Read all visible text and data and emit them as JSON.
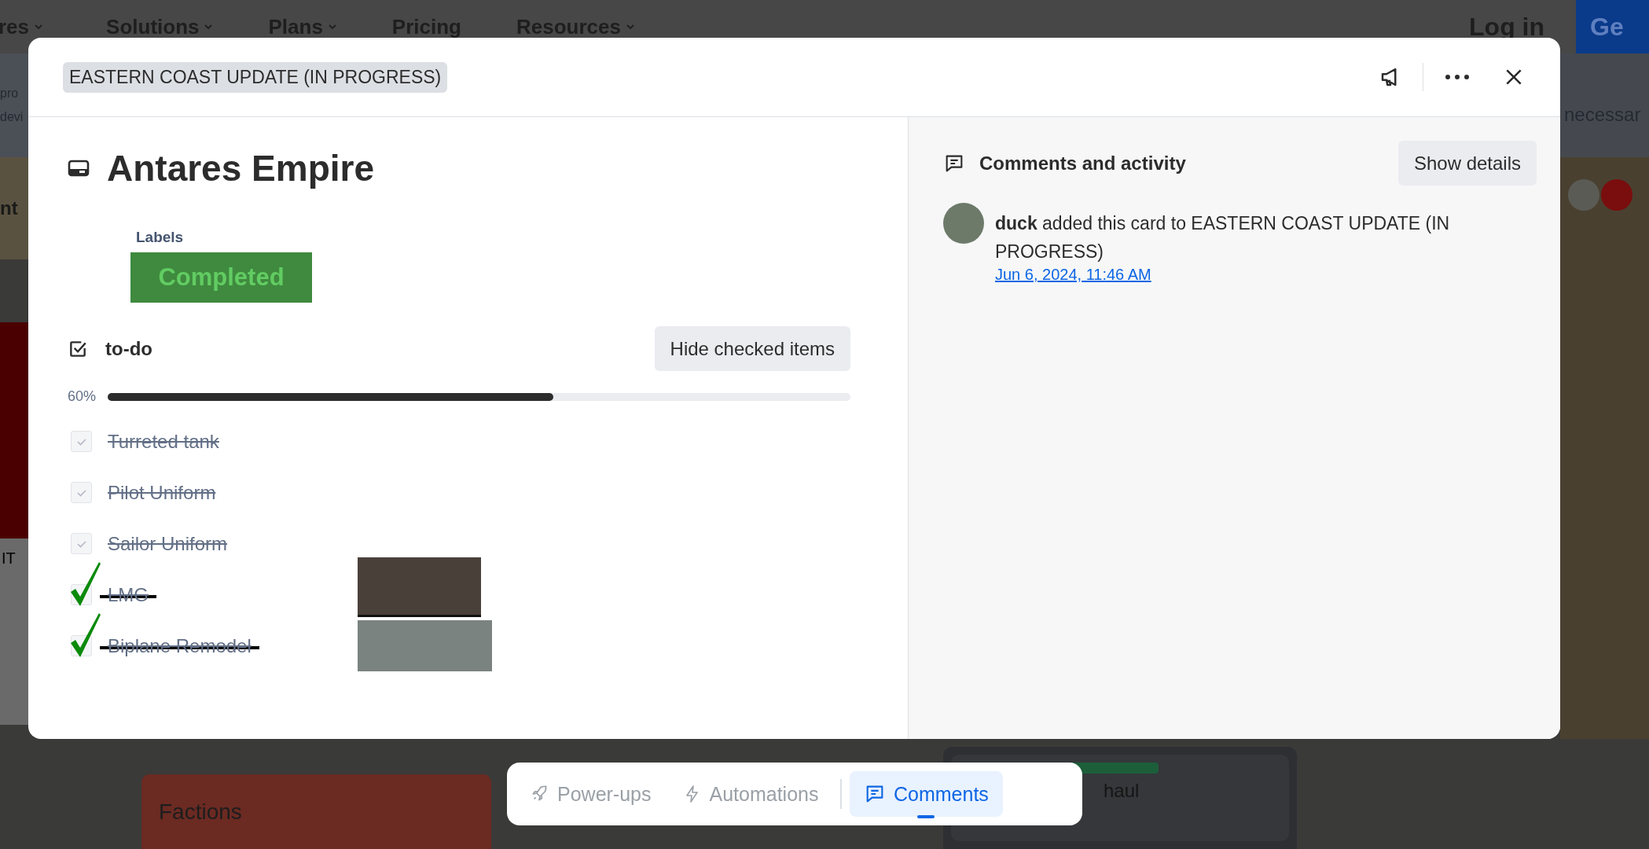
{
  "nav": {
    "items": [
      {
        "label": "res",
        "caret": true
      },
      {
        "label": "Solutions",
        "caret": true
      },
      {
        "label": "Plans",
        "caret": true
      },
      {
        "label": "Pricing",
        "caret": false
      },
      {
        "label": "Resources",
        "caret": true
      }
    ],
    "login": "Log in",
    "cta": "Ge"
  },
  "background": {
    "left_fragments": [
      "pro",
      "devi"
    ],
    "left_heading": "nt",
    "left_card_text": "IT",
    "right_fragment": "necessar",
    "board_cards": [
      {
        "title": "Factions",
        "kind": "red"
      },
      {
        "title": "haul",
        "kind": "labeled"
      }
    ]
  },
  "card": {
    "list_name": "EASTERN COAST UPDATE (IN PROGRESS)",
    "title": "Antares Empire",
    "labels_heading": "Labels",
    "labels": [
      {
        "name": "Completed",
        "color": "#3f8a3f"
      }
    ],
    "checklist": {
      "title": "to-do",
      "hide_button": "Hide checked items",
      "percent": "60%",
      "level": 0.6,
      "items": [
        {
          "text": "Turreted tank",
          "checked": true,
          "kind": "plain"
        },
        {
          "text": "Pilot Uniform",
          "checked": true,
          "kind": "plain"
        },
        {
          "text": "Sailor Uniform",
          "checked": true,
          "kind": "plain"
        },
        {
          "text": "LMG",
          "checked": true,
          "kind": "annotated"
        },
        {
          "text": "Biplane Remodel",
          "checked": true,
          "kind": "annotated"
        }
      ]
    }
  },
  "activity": {
    "heading": "Comments and activity",
    "button": "Show details",
    "entries": [
      {
        "text": "**duck** added this card to EASTERN COAST UPDATE (IN PROGRESS)",
        "time": "Jun 6, 2024, 11:46 AM"
      }
    ]
  },
  "toolbar": [
    {
      "label": "Power-ups",
      "kind": "rocket",
      "selected": false
    },
    {
      "label": "Automations",
      "kind": "bolt",
      "selected": false
    },
    {
      "label": "Comments",
      "kind": "comment",
      "selected": true
    }
  ]
}
